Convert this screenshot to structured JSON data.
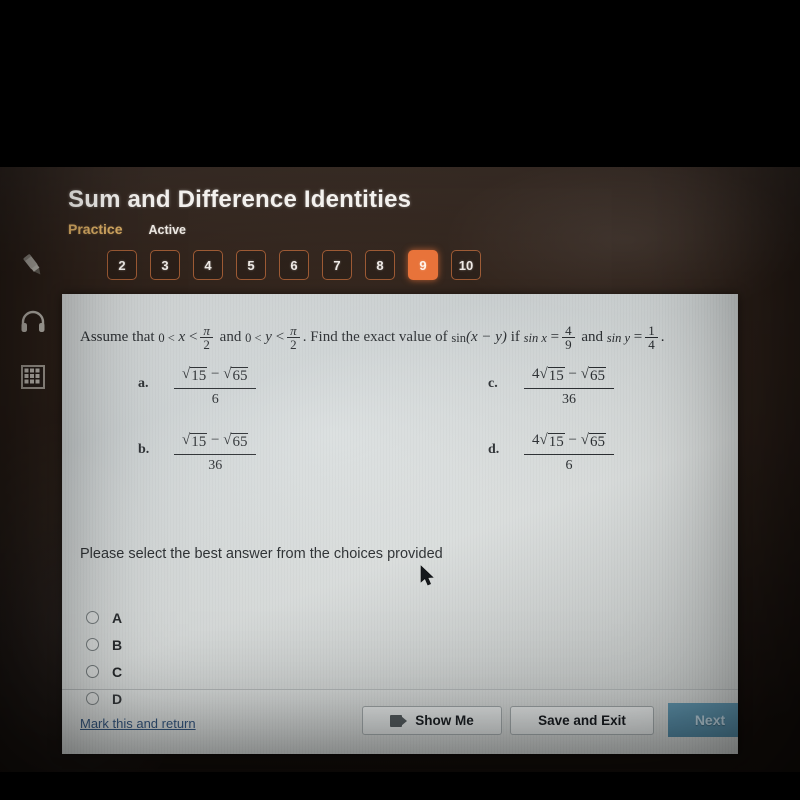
{
  "header": {
    "course_title": "Sum and Difference Identities",
    "section_label": "Practice",
    "status_label": "Active"
  },
  "rail": {
    "icons": [
      "highlighter-icon",
      "headphones-icon",
      "calculator-icon"
    ]
  },
  "tabs": {
    "items": [
      "2",
      "3",
      "4",
      "5",
      "6",
      "7",
      "8",
      "9",
      "10"
    ],
    "current": "9"
  },
  "question": {
    "part1": "Assume that",
    "ineq1_left": "0 <",
    "ineq1_var": "x",
    "ineq1_rel": "<",
    "frac1_num": "π",
    "frac1_den": "2",
    "and1": "and",
    "ineq2_left": "0 <",
    "ineq2_var": "y",
    "ineq2_rel": "<",
    "frac2_num": "π",
    "frac2_den": "2",
    "part2": ". Find the exact value of",
    "expr": "sin",
    "expr_arg": "(x − y)",
    "part3": "if",
    "sinx": "sin x",
    "eq1": "=",
    "frac3_num": "4",
    "frac3_den": "9",
    "and2": "and",
    "siny": "sin y",
    "eq2": "=",
    "frac4_num": "1",
    "frac4_den": "4",
    "period": "."
  },
  "choices": [
    {
      "letter": "a.",
      "coefficient": "",
      "radicand1": "15",
      "operator": "−",
      "radicand2": "65",
      "denominator": "6"
    },
    {
      "letter": "b.",
      "coefficient": "",
      "radicand1": "15",
      "operator": "−",
      "radicand2": "65",
      "denominator": "36"
    },
    {
      "letter": "c.",
      "coefficient": "4",
      "radicand1": "15",
      "operator": "−",
      "radicand2": "65",
      "denominator": "36"
    },
    {
      "letter": "d.",
      "coefficient": "4",
      "radicand1": "15",
      "operator": "−",
      "radicand2": "65",
      "denominator": "6"
    }
  ],
  "prompt": "Please select the best answer from the choices provided",
  "answers": [
    {
      "label": "A",
      "selected": false
    },
    {
      "label": "B",
      "selected": false
    },
    {
      "label": "C",
      "selected": false
    },
    {
      "label": "D",
      "selected": false
    }
  ],
  "footer": {
    "mark_link": "Mark this and return",
    "show_me": "Show Me",
    "save_exit": "Save and Exit",
    "next": "Next"
  },
  "colors": {
    "accent_orange": "#e8733a",
    "practice_gold": "#d7ab63",
    "next_teal": "#53879f",
    "link_blue": "#2d4f78",
    "card_bg": "#d7dbdb",
    "screen_bg": "#2b1f18"
  }
}
